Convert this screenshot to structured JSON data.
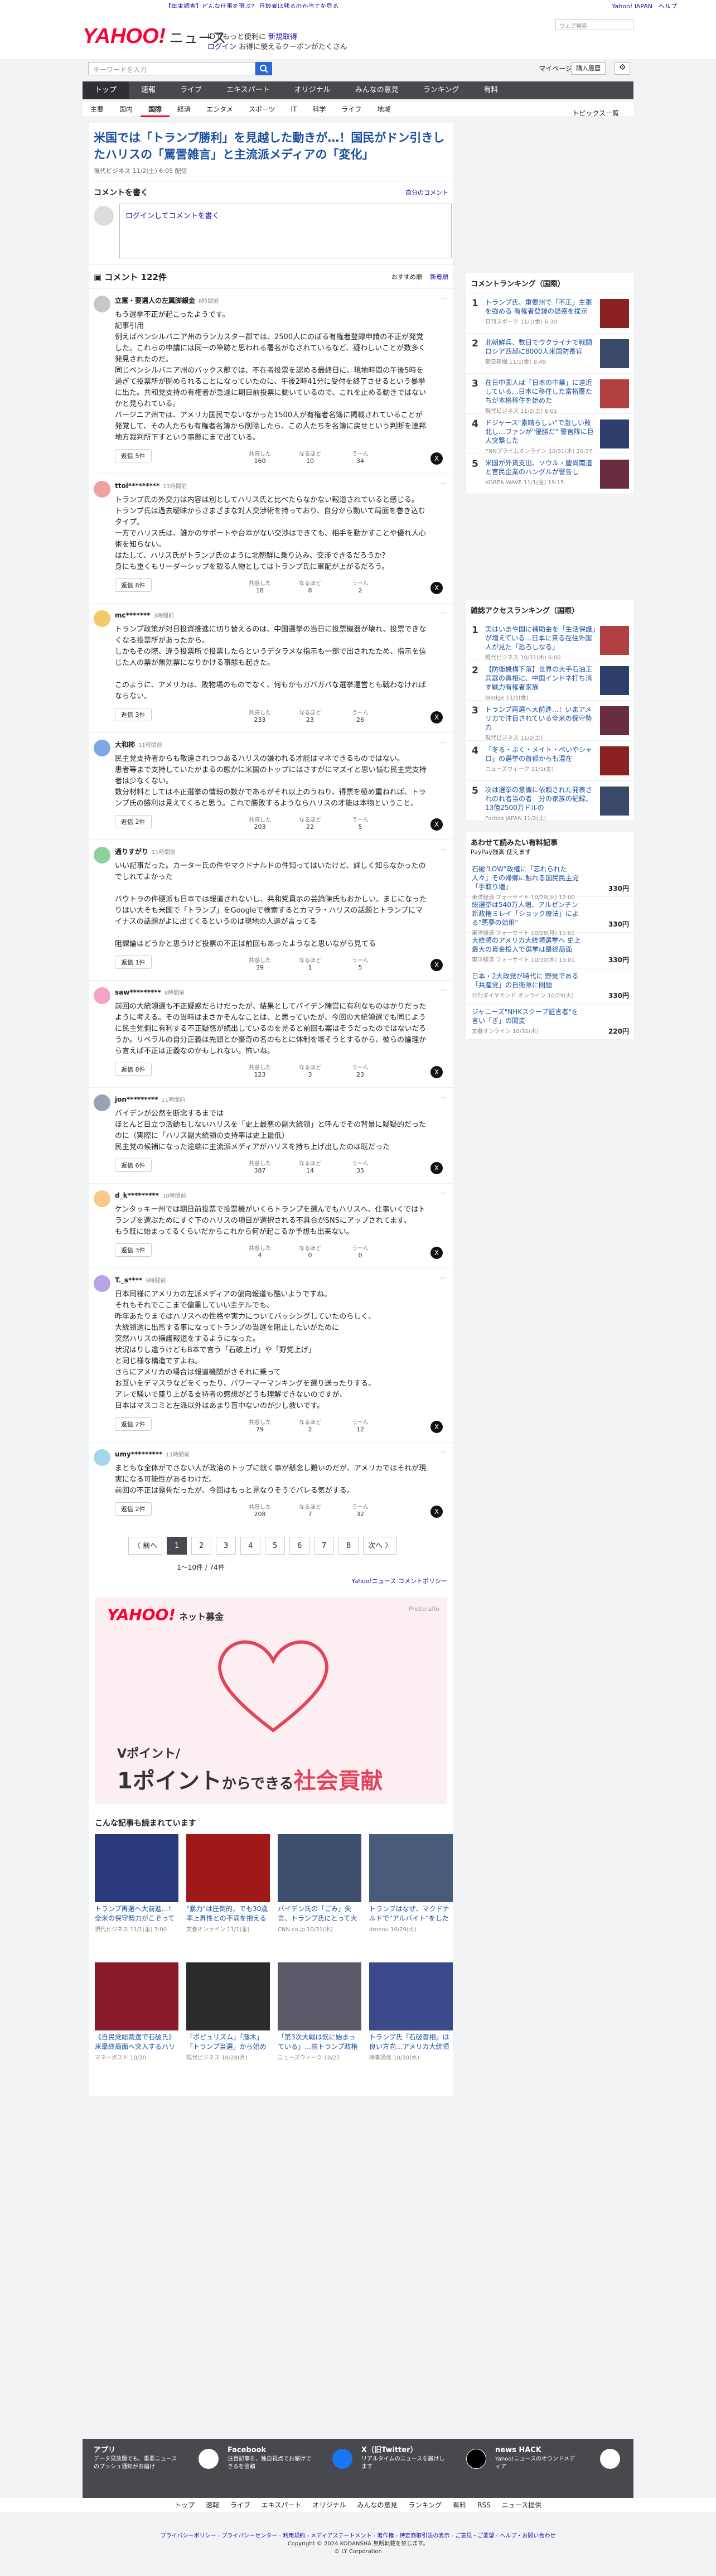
{
  "top": {
    "pr": "【年末調査】どんな仕事を選ぶ？ 月数者は残るのか当てを見る",
    "links": "Yahoo! JAPAN　ヘルプ",
    "search_placeholder": "ウェブ検索"
  },
  "header": {
    "logo": "YAHOO!",
    "logo_sub": "ニュース",
    "msg1": "IDでもっと便利に",
    "msg1_link": "新規取得",
    "msg2": "ログイン",
    "msg2_rest": "お得に使えるクーポンがたくさん"
  },
  "searchbar": {
    "placeholder": "キーワードを入力",
    "mypage": "マイページ",
    "purchase": "購入履歴"
  },
  "gnav": [
    "トップ",
    "速報",
    "ライブ",
    "エキスパート",
    "オリジナル",
    "みんなの意見",
    "ランキング",
    "有料"
  ],
  "snav": [
    "主要",
    "国内",
    "国際",
    "経済",
    "エンタメ",
    "スポーツ",
    "IT",
    "科学",
    "ライフ",
    "地域"
  ],
  "topics_label": "トピックス一覧",
  "article": {
    "title": "米国では「トランプ勝利」を見越した動きが…！国民がドン引きしたハリスの「罵詈雑言」と主流派メディアの「変化」",
    "source": "現代ビジネス 11/2(土) 6:05 配信"
  },
  "comment_write": {
    "heading": "コメントを書く",
    "policy": "自分のコメント",
    "input_text": "ログインしてコメントを書く"
  },
  "comments_header": {
    "count": "コメント 122件",
    "sort_label": "おすすめ順",
    "sort_alt": "新着順"
  },
  "comments": [
    {
      "name": "立憲・要選人の左翼脚銀金",
      "time": "8時間前",
      "body": "もう選挙不正が起こったようです。\n記事引用\n例えばペンシルバニア州のランカスター郡では、2500人にのぼる有権者登録申請の不正が発覚した。これらの申請には同一の筆跡と思われる署名がなされているなど、疑わしいことが数多く発見されたのだ。\n同じペンシルバニア州のバックス郡では、不在者投票を認める最終日に、現地時間の午後5時を過ぎて投票所が閉められることになっていたのに、午後2時41分に受付を終了させるという暴挙に出た。共和党支持の有権者が急遽に期日前投票に動いているので、これを止める動きではないかと見られている。\nバージニア州では、アメリカ国民でないなかった1500人が有権者名簿に掲載されていることが発覚して、その人たちも有権者名簿から削除したら、この人たちを名簿に戻せという判断を連邦地方裁判所下すという事態にまで出ている。",
      "replies": "返信 5件",
      "agree": "160",
      "ohmm": "10",
      "hmm": "34"
    },
    {
      "name": "ttoi*********",
      "time": "11時間前",
      "body": "トランプ氏の外交力は内容は別としてハリス氏と比べたらなかない報道されていると感じる。\nトランプ氏は過去曖昧からさまざまな対人交渉術を持っており、自分から動いて局面を巻き込むタイプ。\n一方でハリス氏は、誰かのサポートや台本がない交渉はできても、相手を動かすことや優れ人心術を知らない。\nはたして、ハリス氏がトランプ氏のように北朝鮮に乗り込み、交渉できるだろうか？\n身にも重くもリーダーシップを取る人物としてはトランプ氏に軍配が上がるだろう。",
      "replies": "返信 8件",
      "agree": "18",
      "ohmm": "8",
      "hmm": "2"
    },
    {
      "name": "mc*******",
      "time": "3時間前",
      "body": "トランプ政策が対日投資推進に切り替えるのは、中国選挙の当日に投票機器が壊れ、投票できなくなる投票所があったから。\nしかもその際、違う投票所で投票したらというデタラメな指示も一部で出されたため、指示を信じた人の票が無効票になりかける事態も起きた。\n\nこのように、アメリカは、敗物場のものでなく、何もかもガバガバな選挙運営とも戦わなければならない。",
      "replies": "返信 3件",
      "agree": "233",
      "ohmm": "23",
      "hmm": "26"
    },
    {
      "name": "大和柿",
      "time": "11時間前",
      "body": "民主党支持者からも敬遠されつつあるハリスの嫌われる才能はマネできるものではない。\n患者等まで支持していたがまるの態かに米国のトップにはさすがにマズイと思い悩む民主党支持者は少なくない。\n数分材料としては不正選挙の情報の数かであるがそれ以上のうねり、得票を極め重ねれば、トランプ氏の勝利は見えてくると思う。これで勝敗するようならハリスの才能は本物ということ。",
      "replies": "返信 2件",
      "agree": "203",
      "ohmm": "22",
      "hmm": "5"
    },
    {
      "name": "通りすがり",
      "time": "11時間前",
      "body": "いい記事だった。カーター氏の件やマクドナルドの件知ってはいたけど、詳しく知らなかったのでしれてよかった\n\nバウトラの件硬派も日本では報道されないし、共和党員示の芸論陳氏もおかしい。まじになったりはい大そも米国で「トランプ」をGoogleで検索するとカマラ・ハリスの話題とトランプにマイナスの話題がよに出てくるというのは現地の人達が言ってる\n\n阻課論はどうかと思うけど投票の不正は前回もあったようなと思いながら見てる",
      "replies": "返信 1件",
      "agree": "39",
      "ohmm": "1",
      "hmm": "5"
    },
    {
      "name": "saw*********",
      "time": "8時間前",
      "body": "前回の大統領選も不正疑惑だらけだったが、結果としてバイデン陣営に有利なものはかりだったように考える。その当時はまさかそんなことは、と思っていたが、今回の大統領選でも同じように民主党側に有利する不正疑惑が続出しているのを見ると前回も案はそうだったのではないだろうか。リベラルの自分正義は先頭とか豪奇の名のもとに体制を壊そうとするから、彼らの論理から言えば不正は正義なのかもしれない。怖いね。",
      "replies": "返信 8件",
      "agree": "123",
      "ohmm": "3",
      "hmm": "23"
    },
    {
      "name": "jon*********",
      "time": "11時間前",
      "body": "バイデンが公然を断念するまでは\nほとんど目立つ活動もしないハリスを「史上最悪の副大統領」と呼んでその背景に疑疑的だったのに（実際に「ハリス副大統領の支持率は史上最低）\n民主党の候補になった途端に主流派メディアがハリスを持ち上げ出したのは既だった",
      "replies": "返信 6件",
      "agree": "387",
      "ohmm": "14",
      "hmm": "35"
    },
    {
      "name": "d_k*********",
      "time": "10時間前",
      "body": "ケンタッキー州では期日前投票で投票機がいくらトランプを選んでもハリスへ、仕事いくではトランプを選ぶためにすぐ下のハリスの項目が選択される不具合がSNSにアップされてます。\nもう既に始まってるくらいだからこれから何が起こるか予想も出来ない。",
      "replies": "返信 3件",
      "agree": "4",
      "ohmm": "0",
      "hmm": "0"
    },
    {
      "name": "T._s****",
      "time": "9時間前",
      "body": "日本同様にアメリカの左派メディアの偏向報道も酷いようですね。\nそれもそれでここまで偏重していい主テルでも、\n昨年あたりまではハリスへの性格や実力についてバッシングしていたのらしく、\n大統領選に出馬する事になってトランプの当選を阻止したいがために\n突然ハリスの擁護報道をするようになった。\n状況はりし違うけどもB本で言う「石破上げ」や「野党上げ」\nと同じ様な構造ですよね。\nさらにアメリカの場合は報道機関がさそれに乗って\nお互いをデマスラなどをくったり、バワーマーマンキングを選り送ったりする。\nアレで騒いで盛り上がる支持者の感想がどうも理解できないのですが、\n日本はマスコミと左派以外はあまり盲中ないのが少し救いです。",
      "replies": "返信 2件",
      "agree": "79",
      "ohmm": "2",
      "hmm": "12"
    },
    {
      "name": "umy*********",
      "time": "11時間前",
      "body": "まともな全体がでさない人が政治のトップに就く事が懸念し難いのだが、アメリカではそれが現実になる可能性があるわけだ。\n前回の不正は露骨だったが、今回はもっと見なりそうでバレる気がする。",
      "replies": "返信 2件",
      "agree": "208",
      "ohmm": "7",
      "hmm": "32"
    }
  ],
  "reaction_labels": {
    "agree": "共感した",
    "ohmm": "なるほど",
    "hmm": "うーん"
  },
  "pager": {
    "prev": "〈 前へ",
    "pages": [
      "1",
      "2",
      "3",
      "4",
      "5",
      "6",
      "7",
      "8"
    ],
    "next": "次へ 〉",
    "count": "1〜10件 / 74件",
    "policy": "Yahoo!ニュース コメントポリシー"
  },
  "banner": {
    "logo": "YAHOO!",
    "logo_sub": "ネット募金",
    "credit": "Photo:afio",
    "text1": "Vポイント/",
    "text2a": "1ポイント",
    "text2b": "からできる",
    "text2c": "社会貢献"
  },
  "related": {
    "heading": "こんな記事も読まれています",
    "items": [
      {
        "title": "トランプ再選へ大前進…！ 全米の保守勢力がこぞって支持",
        "src": "現代ビジネス 11/1(金) 7:00"
      },
      {
        "title": "\"暴力\"は圧倒的、でも30歳率上昇性との不満を抱えるハリス…",
        "src": "文春オンライン 11/1(金)"
      },
      {
        "title": "バイデン氏の「ごみ」失言、トランプ氏にとって大きな象徴が",
        "src": "CNN.co.jp 10/31(木)"
      },
      {
        "title": "トランプはなぜ、マクドナルドで\"アルバイト\"をしたのか？",
        "src": "dmenu 10/29(火)"
      },
      {
        "title": "《自民党総裁選で石破氏》米最終局面へ突入するハリス選挙",
        "src": "マネーポスト 10/30"
      },
      {
        "title": "「ポピュリズム」「藤木」「トランプ当選」から始める米大統領",
        "src": "現代ビジネス 10/28(月)"
      },
      {
        "title": "「第3次大戦は既に始まっている」…前トランプ政権の大物が語る",
        "src": "ニューズウィーク 10/27"
      },
      {
        "title": "トランプ氏「石破首相」は良い方向…アメリカ大統領選",
        "src": "時事通信 10/30(水)"
      }
    ]
  },
  "ranking": {
    "heading": "コメントランキング（国際）",
    "items": [
      {
        "rank": "1",
        "title": "トランプ氏、重要州で「不正」主張を強める 有権者登録の疑惑を提示",
        "src": "日刊スポーツ 11/1(金) 6:30",
        "count": "7/1"
      },
      {
        "rank": "2",
        "title": "北朝鮮兵、数日でウクライナで戦闘 ロシア西部に8000人米国防長官",
        "src": "朝日新聞 11/1(金) 8:49",
        "count": ""
      },
      {
        "rank": "3",
        "title": "在日中国人は「日本の中華」に遠近している…日本に移住した富裕層たちが本格移住を始めた",
        "src": "現代ビジネス 11/2(土) 6:01",
        "count": "6/5"
      },
      {
        "rank": "4",
        "title": "ドジャース\"素晴らしい\"で激しい敗北し…ファンが\"優勝だ\" 警官隊に巨人突撃した",
        "src": "FNNプライムオンライン 10/31(木) 20:37",
        "count": "4/9"
      },
      {
        "rank": "5",
        "title": "米国が外貨支出、ソウル・慶尚南道と官民企業のハングルが警告し",
        "src": "KOREA WAVE 11/1(金) 19:15",
        "count": ""
      }
    ]
  },
  "access_ranking": {
    "heading": "雑誌アクセスランキング（国際）",
    "items": [
      {
        "rank": "1",
        "title": "実はいまや国に補助金を「生活保護」が増えている…日本に来る在住外国人が見た「恐ろしなる」",
        "src": "現代ビジネス 10/31(木) 6:00"
      },
      {
        "rank": "2",
        "title": "【防衛機構下落】世界の大手石油王兵器の真相に、中国インドネ打ち消す戦力有権者家族",
        "src": "Wedge 11/1(金)"
      },
      {
        "rank": "3",
        "title": "トランプ再選へ大前進…！いまアメリカで注目されている全米の保守勢力",
        "src": "現代ビジネス 11/2(土)"
      },
      {
        "rank": "4",
        "title": "「冬る・ぶく・メイト・ぺいやシャロ」の選挙の首都からも混在",
        "src": "ニューズウィーク 11/1(金)"
      },
      {
        "rank": "5",
        "title": "次は選挙の意識に依頼された発表されのれ者当の者　分の家族の記録、13億2500万ドルの",
        "src": "Forbes JAPAN 11/2(土)"
      }
    ]
  },
  "paid": {
    "heading": "あわせて読みたい有料記事",
    "sub": "PayPay残高 使えます",
    "items": [
      {
        "title": "石破\"LOW\"政権に「忘れられた人々」その帰郷に触れる国民民主党「手取り増」",
        "src": "東洋経済 フォーサイト 10/29(火) 12:00",
        "price": "330円"
      },
      {
        "title": "総選挙は540万人増、アルゼンチン新政権ミレイ「ショック療法」による\"悪夢の効用\"",
        "src": "東洋経済 フォーサイト 10/28(月) 11:01",
        "price": "330円"
      },
      {
        "title": "大統領のアメリカ大統領選挙へ 史上最大の資金投入で選挙は最終局面",
        "src": "東洋経済 フォーサイト 10/30(水) 15:01",
        "price": "330円"
      },
      {
        "title": "日本・2大政党が時代に 野党である「共産党」の自衛隊に問題",
        "src": "日刊ダイヤモンド オンライン 10/29(火)",
        "price": "330円"
      },
      {
        "title": "ジャニーズ\"NHKスクープ証言者\"を言い「ぎ」の間変",
        "src": "文春オンライン 10/31(木)",
        "price": "220円"
      }
    ]
  },
  "footer": {
    "app_title": "アプリ",
    "app_desc": "データ見放題でも、重要ニュースのプッシュ通知がお届け",
    "fb_title": "Facebook",
    "fb_desc": "注目記事を、独自視点でお届けできるを信頼",
    "x_title": "X（旧Twitter）",
    "x_desc": "リアルタイムのニュースを届けします",
    "hack_title": "news HACK",
    "hack_desc": "Yahoo!ニュースのオウンドメディア",
    "nav": [
      "トップ",
      "速報",
      "ライブ",
      "エキスパート",
      "オリジナル",
      "みんなの意見",
      "ランキング",
      "有料",
      "RSS",
      "ニュース提供"
    ],
    "links1": "プライバシーポリシー - プライバシーセンター - 利用規約 - メディアステートメント - 著作権 - 特定商取引法の表示 - ご意見・ご要望 - ヘルプ・お問い合わせ",
    "copyright": "Copyright © 2024 KODANSHA 無断転載を禁じます。",
    "lycorp": "© LY Corporation"
  },
  "colors": {
    "brand_red": "#ff0033",
    "nav_dark": "#47494e",
    "link": "#1a0dab"
  }
}
